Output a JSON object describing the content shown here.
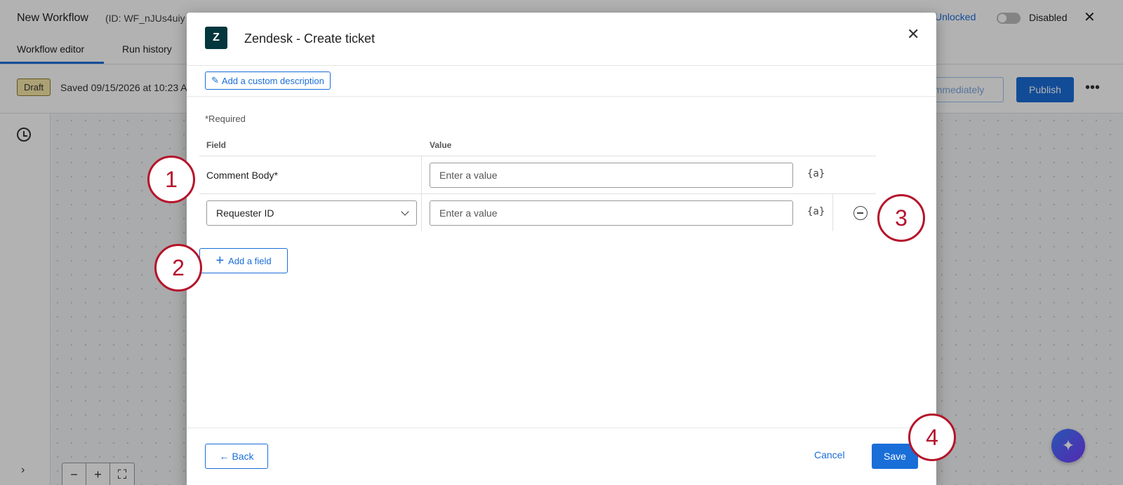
{
  "app": {
    "title": "New Workflow",
    "id_text": "(ID: WF_nJUs4uiy",
    "lock_label": "Unlocked",
    "status_label": "Disabled",
    "tabs": [
      {
        "label": "Workflow editor"
      },
      {
        "label": "Run history"
      }
    ],
    "badge": "Draft",
    "saved_text": "Saved 09/15/2026 at 10:23 A",
    "immediately_label": "immediately",
    "publish_label": "Publish",
    "more_label": "•••",
    "zoom": {
      "minus": "−",
      "plus": "+",
      "fit": "⛶"
    }
  },
  "modal": {
    "title": "Zendesk - Create ticket",
    "logo_glyph": "Z",
    "close_glyph": "✕",
    "custom_description_label": "Add a custom description",
    "required_note": "*Required",
    "columns": {
      "field": "Field",
      "value": "Value"
    },
    "rows": [
      {
        "field": "Comment Body*",
        "placeholder": "Enter a value",
        "piped": "{a}"
      },
      {
        "field": "Requester ID",
        "placeholder": "Enter a value",
        "piped": "{a}"
      }
    ],
    "add_field_label": "Add a field",
    "back_label": "Back",
    "cancel_label": "Cancel",
    "save_label": "Save"
  },
  "callouts": [
    "1",
    "2",
    "3",
    "4"
  ],
  "colors": {
    "accent": "#1a6ed8",
    "callout": "#b5142b",
    "zendesk": "#03363d",
    "draft_badge": "#f7e7a8"
  },
  "icons": [
    "history-icon",
    "zendesk-logo-icon",
    "close-icon",
    "edit-icon",
    "piped-text-icon",
    "remove-circle-icon",
    "plus-icon",
    "arrow-left-icon",
    "chevron-down-icon",
    "sparkle-icon"
  ]
}
